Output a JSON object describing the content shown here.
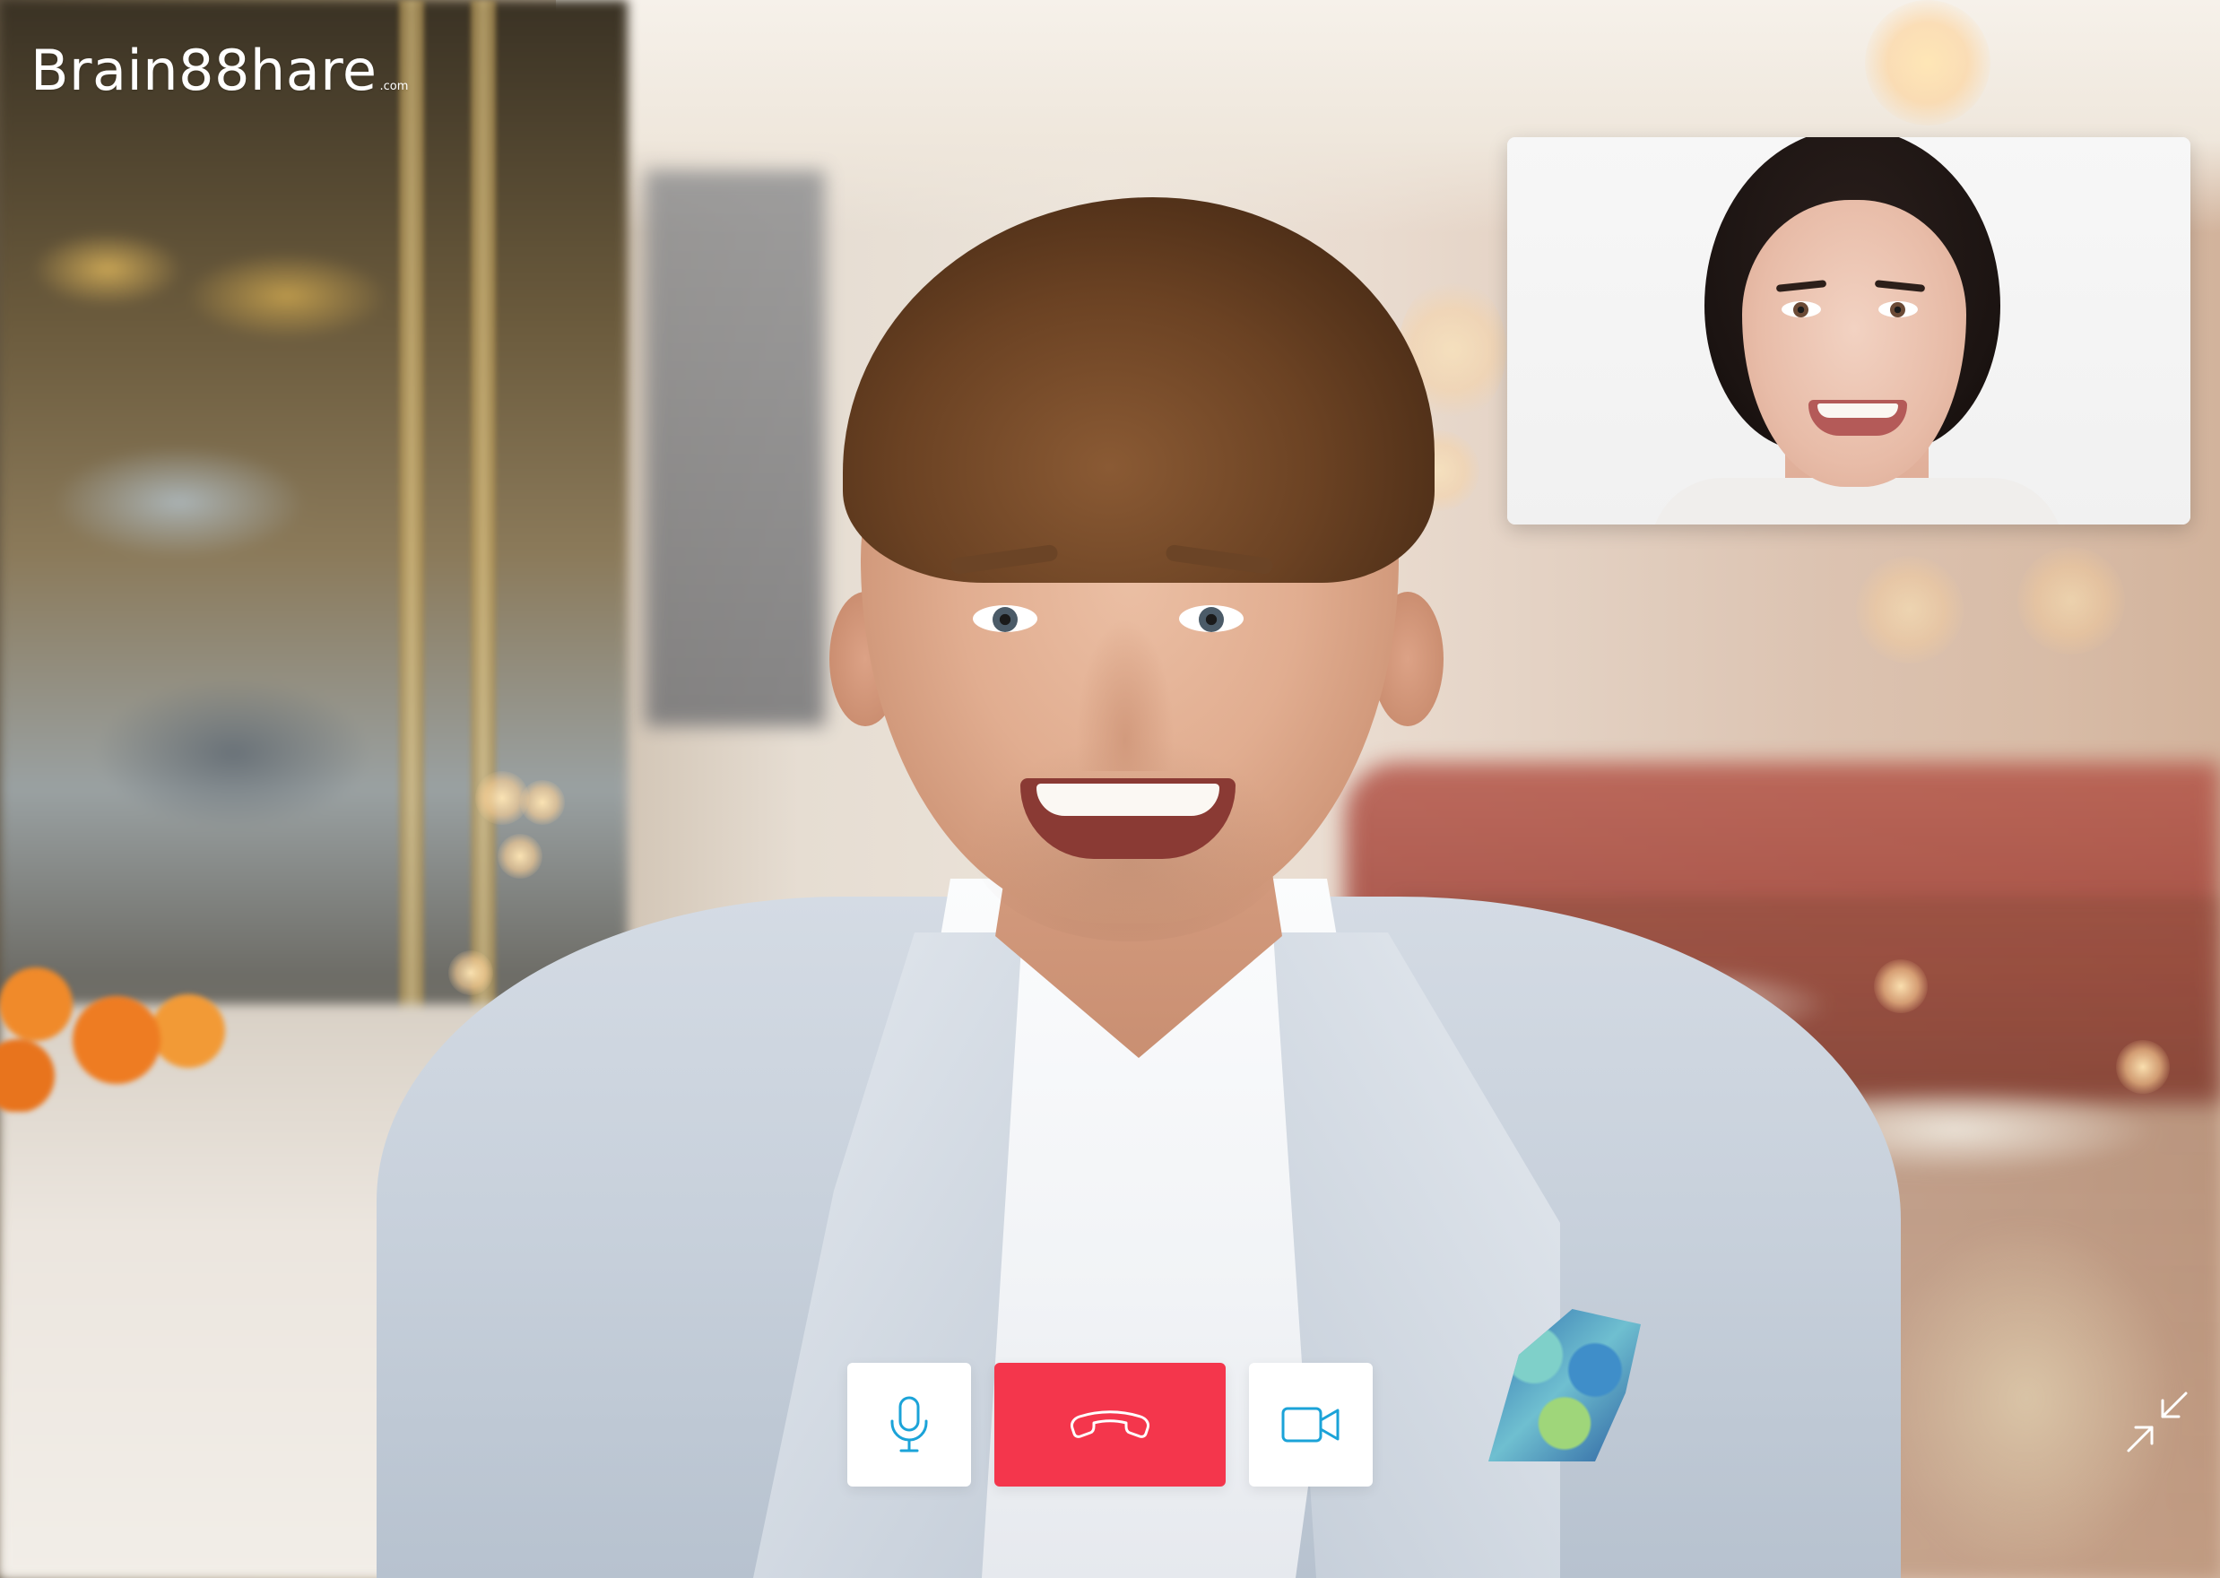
{
  "app": {
    "brand": {
      "name": "Brain88hare",
      "suffix": ".com"
    }
  },
  "call": {
    "main_participant": "main-video",
    "self_view": "pip-video",
    "controls": [
      {
        "id": "mic",
        "icon": "microphone-icon",
        "label": ""
      },
      {
        "id": "end",
        "icon": "phone-hangup-icon",
        "label": ""
      },
      {
        "id": "camera",
        "icon": "video-camera-icon",
        "label": ""
      }
    ],
    "minimize_icon": "minimize-arrows-icon"
  },
  "colors": {
    "end_call": "#f4364c",
    "control_icon": "#1ba3d8",
    "control_bg": "#ffffff",
    "logo": "#ffffff"
  }
}
